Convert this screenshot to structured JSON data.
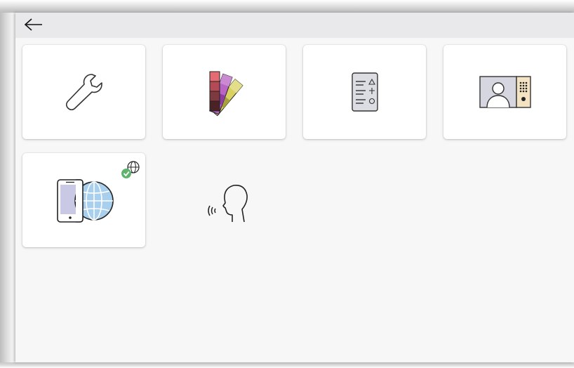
{
  "header": {
    "back_icon": "arrow-left-icon"
  },
  "tiles": [
    {
      "icon": "wrench-icon"
    },
    {
      "icon": "color-swatches-icon"
    },
    {
      "icon": "event-log-icon"
    },
    {
      "icon": "door-station-icon"
    },
    {
      "icon": "mobile-globe-icon",
      "badge": "globe-check-badge-icon"
    },
    {
      "icon": "voice-speech-icon"
    }
  ],
  "colors": {
    "window_bg": "#f7f7f7",
    "topbar_bg": "#e9e9ec",
    "tile_bg": "#ffffff",
    "success_green": "#5fb36d",
    "globe_blue": "#a8cfee"
  }
}
